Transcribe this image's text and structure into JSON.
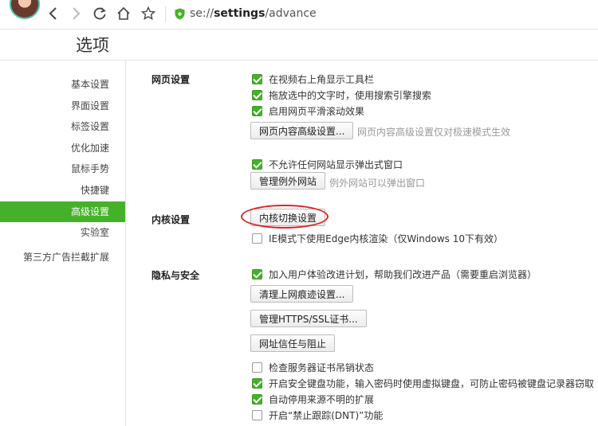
{
  "browser": {
    "url_scheme": "se://",
    "url_bold": "settings",
    "url_path": "/advance"
  },
  "page": {
    "title": "选项"
  },
  "sidebar": {
    "items": [
      {
        "label": "基本设置"
      },
      {
        "label": "界面设置"
      },
      {
        "label": "标签设置"
      },
      {
        "label": "优化加速"
      },
      {
        "label": "鼠标手势"
      },
      {
        "label": "快捷键"
      },
      {
        "label": "高级设置",
        "active": true
      },
      {
        "label": "实验室"
      },
      {
        "label": "第三方广告拦截扩展"
      }
    ]
  },
  "sections": {
    "web": {
      "title": "网页设置",
      "options": [
        {
          "label": "在视频右上角显示工具栏",
          "checked": true
        },
        {
          "label": "拖放选中的文字时，使用搜索引擎搜索",
          "checked": true
        },
        {
          "label": "启用网页平滑滚动效果",
          "checked": true
        }
      ],
      "advanced_button": "网页内容高级设置...",
      "advanced_hint": "网页内容高级设置仅对极速模式生效",
      "popup_option": {
        "label": "不允许任何网站显示弹出式窗口",
        "checked": true
      },
      "exceptions_button": "管理例外网站",
      "exceptions_hint": "例外网站可以弹出窗口"
    },
    "kernel": {
      "title": "内核设置",
      "switch_button": "内核切换设置",
      "edge_option": {
        "label": "IE模式下使用Edge内核渲染（仅Windows 10下有效）",
        "checked": false
      }
    },
    "privacy": {
      "title": "隐私与安全",
      "improve_option": {
        "label": "加入用户体验改进计划，帮助我们改进产品（需要重启浏览器）",
        "checked": true
      },
      "clear_button": "清理上网痕迹设置...",
      "https_button": "管理HTTPS/SSL证书...",
      "trust_button": "网址信任与阻止",
      "options": [
        {
          "label": "检查服务器证书吊销状态",
          "checked": false
        },
        {
          "label": "开启安全键盘功能，输入密码时使用虚拟键盘，可防止密码被键盘记录器窃取",
          "checked": true
        },
        {
          "label": "自动停用来源不明的扩展",
          "checked": true
        },
        {
          "label": "开启“禁止跟踪(DNT)”功能",
          "checked": false
        }
      ]
    }
  },
  "colors": {
    "accent": "#45b12a",
    "highlight_ring": "#e02424"
  }
}
